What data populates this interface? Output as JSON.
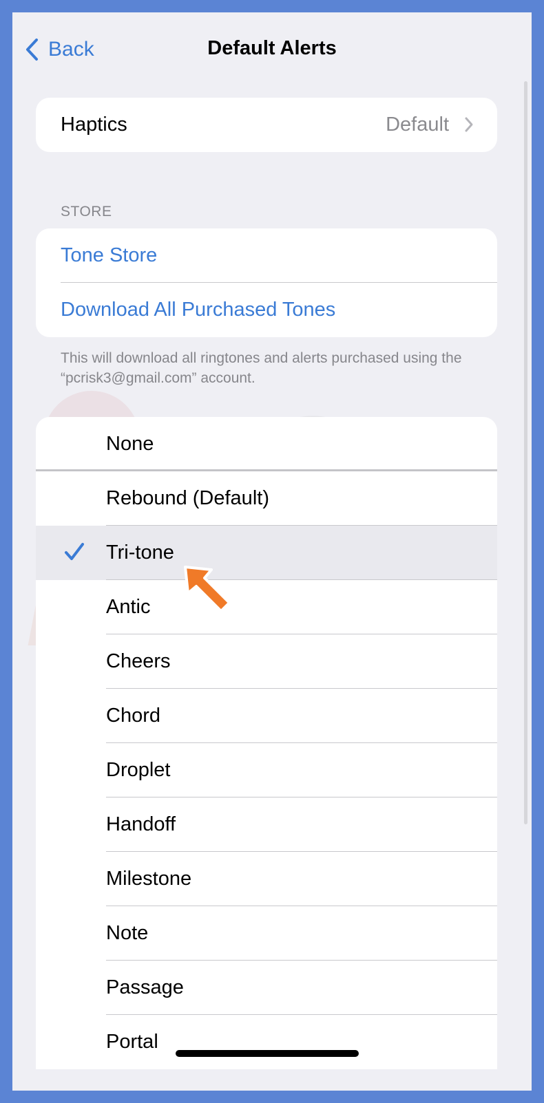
{
  "nav": {
    "back_label": "Back",
    "title": "Default Alerts"
  },
  "haptics": {
    "label": "Haptics",
    "value": "Default"
  },
  "store": {
    "header": "STORE",
    "items": [
      {
        "label": "Tone Store"
      },
      {
        "label": "Download All Purchased Tones"
      }
    ],
    "footer": "This will download all ringtones and alerts purchased using the “pcrisk3@gmail.com” account."
  },
  "tones": {
    "selected": "Tri-tone",
    "items": [
      {
        "label": "None"
      },
      {
        "label": "Rebound (Default)"
      },
      {
        "label": "Tri-tone"
      },
      {
        "label": "Antic"
      },
      {
        "label": "Cheers"
      },
      {
        "label": "Chord"
      },
      {
        "label": "Droplet"
      },
      {
        "label": "Handoff"
      },
      {
        "label": "Milestone"
      },
      {
        "label": "Note"
      },
      {
        "label": "Passage"
      },
      {
        "label": "Portal"
      }
    ]
  },
  "colors": {
    "accent": "#3a7bd5",
    "frame": "#5b84d4",
    "pointer": "#f07a28"
  },
  "icons": {
    "back": "chevron-left-icon",
    "disclosure": "chevron-right-icon",
    "check": "checkmark-icon"
  }
}
